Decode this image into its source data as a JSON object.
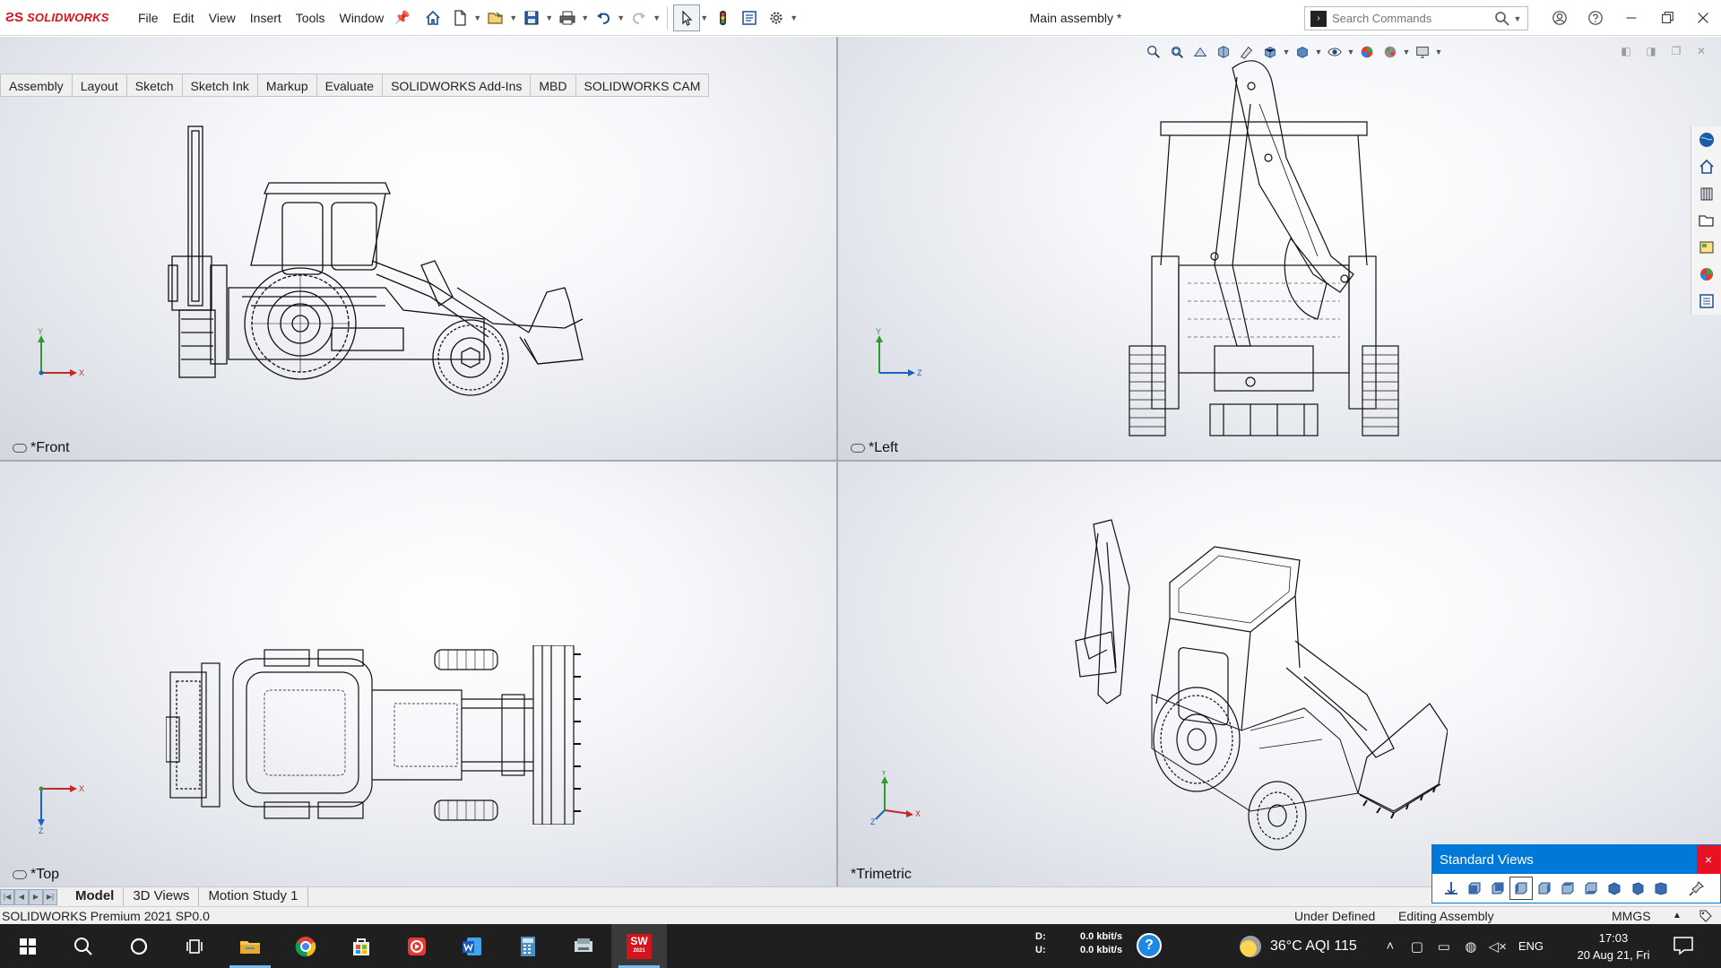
{
  "app": {
    "brand": "SOLIDWORKS",
    "document_title": "Main assembly *",
    "menus": [
      "File",
      "Edit",
      "View",
      "Insert",
      "Tools",
      "Window"
    ]
  },
  "search": {
    "placeholder": "Search Commands"
  },
  "command_tabs": [
    "Assembly",
    "Layout",
    "Sketch",
    "Sketch Ink",
    "Markup",
    "Evaluate",
    "SOLIDWORKS Add-Ins",
    "MBD",
    "SOLIDWORKS CAM"
  ],
  "viewports": {
    "front": {
      "label": "*Front",
      "axes": [
        "Y",
        "X"
      ]
    },
    "left": {
      "label": "*Left",
      "axes": [
        "Y",
        "Z"
      ]
    },
    "top": {
      "label": "*Top",
      "axes": [
        "X",
        "Z"
      ]
    },
    "trimetric": {
      "label": "*Trimetric",
      "axes": [
        "Y",
        "X",
        "Z"
      ]
    }
  },
  "standard_views": {
    "title": "Standard Views",
    "close": "×"
  },
  "bottom_tabs": [
    "Model",
    "3D Views",
    "Motion Study 1"
  ],
  "status": {
    "product": "SOLIDWORKS Premium 2021 SP0.0",
    "definition": "Under Defined",
    "mode": "Editing Assembly",
    "units": "MMGS",
    "caret": "▲"
  },
  "taskbar": {
    "net_down_label": "D:",
    "net_up_label": "U:",
    "net_down": "0.0 kbit/s",
    "net_up": "0.0 kbit/s",
    "help": "?",
    "weather": "36°C AQI 115",
    "language": "ENG",
    "time": "17:03",
    "date": "20 Aug 21, Fri",
    "sw_badge": "SW",
    "sw_year": "2021"
  },
  "colors": {
    "accent": "#0078d7",
    "brand_red": "#d4131b",
    "close_red": "#e81123",
    "taskbar": "#1f1f1f"
  }
}
